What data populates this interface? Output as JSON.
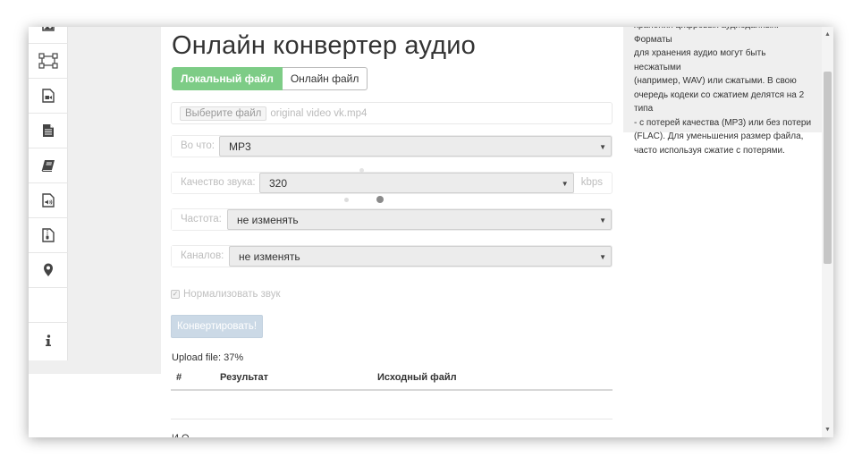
{
  "page": {
    "title": "Онлайн конвертер аудио"
  },
  "sidebar": {
    "icons": [
      "image-icon",
      "vector-icon",
      "video-icon",
      "document-icon",
      "ebook-icon",
      "audio-icon",
      "archive-icon",
      "location-icon",
      "blank",
      "info-icon"
    ]
  },
  "tabs": {
    "local_file": "Локальный файл",
    "online_file": "Онлайн файл"
  },
  "file_input": {
    "button_label": "Выберите файл",
    "file_name": "original video vk.mp4"
  },
  "format": {
    "label": "Во что:",
    "value": "MP3"
  },
  "quality": {
    "label": "Качество звука:",
    "value": "320",
    "unit": "kbps"
  },
  "frequency": {
    "label": "Частота:",
    "value": "не изменять"
  },
  "channels": {
    "label": "Каналов:",
    "value": "не изменять"
  },
  "normalize": {
    "label": "Нормализовать звук",
    "checked": true,
    "mark": "✓"
  },
  "convert_button": {
    "label": "Конвертировать!"
  },
  "upload": {
    "status": "Upload file: 37%"
  },
  "results": {
    "columns": [
      "#",
      "Результат",
      "Исходный файл"
    ]
  },
  "cut_text": "И  О",
  "info": {
    "lines": [
      "хранения цифровых аудиоданных. Форматы",
      "для хранения аудио могут быть несжатыми",
      "(например, WAV) или сжатыми. В свою",
      "очередь кодеки со сжатием делятся на 2 типа",
      "- с потерей качества (MP3) или без потери",
      "(FLAC). Для уменьшения размер файла,",
      "часто используя сжатие с потерями."
    ]
  },
  "colors": {
    "accent_green": "#7dcc86",
    "disabled_blue": "#cbd9e6",
    "panel_gray": "#efefef"
  }
}
